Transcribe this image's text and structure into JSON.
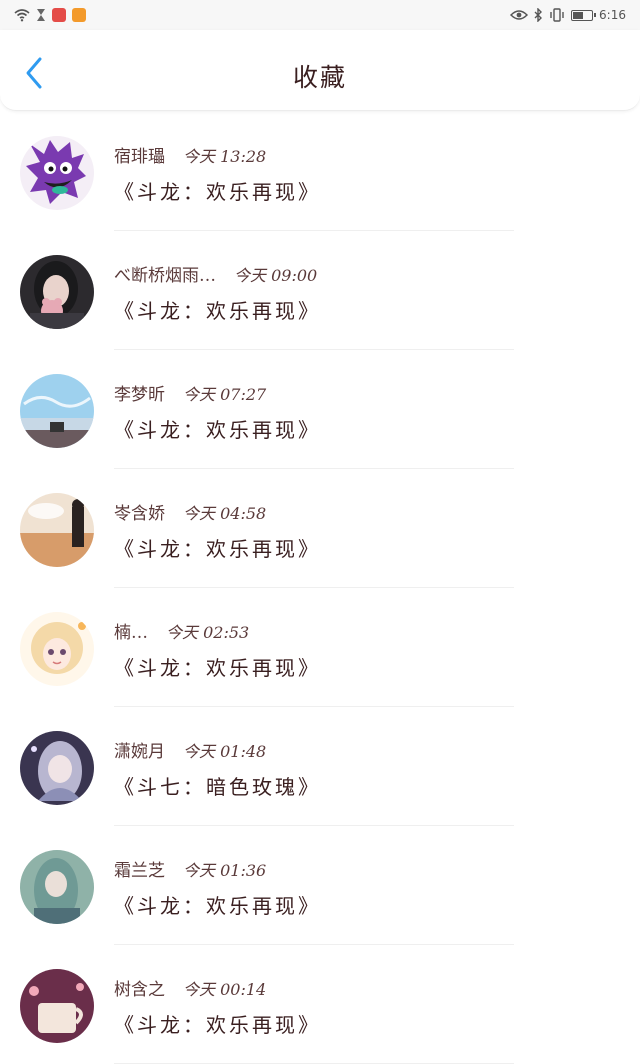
{
  "status_bar": {
    "time": "6:16",
    "icons_left": [
      "wifi-icon",
      "hourglass-icon",
      "red-app-icon",
      "orange-play-app-icon"
    ],
    "icons_right": [
      "eye-icon",
      "bluetooth-icon",
      "vibrate-icon",
      "battery-icon"
    ],
    "battery_fraction": 0.6
  },
  "header": {
    "title": "收藏",
    "back_icon": "chevron-left-icon",
    "accent_color": "#2f9bf0"
  },
  "favorites": [
    {
      "name": "宿琲瓃",
      "time": "今天 13:28",
      "work": "《斗龙：欢乐再现》",
      "avatar": "purple-cartoon-avatar"
    },
    {
      "name": "べ断桥烟雨…",
      "time": "今天 09:00",
      "work": "《斗龙：欢乐再现》",
      "avatar": "girl-with-bear-avatar"
    },
    {
      "name": "李梦昕",
      "time": "今天 07:27",
      "work": "《斗龙：欢乐再现》",
      "avatar": "sky-scene-avatar"
    },
    {
      "name": "岺含娇",
      "time": "今天 04:58",
      "work": "《斗龙：欢乐再现》",
      "avatar": "sunset-field-avatar"
    },
    {
      "name": "楠…",
      "time": "今天 02:53",
      "work": "《斗龙：欢乐再现》",
      "avatar": "anime-blonde-girl-avatar"
    },
    {
      "name": "潇婉月",
      "time": "今天 01:48",
      "work": "《斗七：暗色玫瑰》",
      "avatar": "anime-dark-girl-avatar"
    },
    {
      "name": "霜兰芝",
      "time": "今天 01:36",
      "work": "《斗龙：欢乐再现》",
      "avatar": "teal-hair-girl-avatar"
    },
    {
      "name": "树含之",
      "time": "今天 00:14",
      "work": "《斗龙：欢乐再现》",
      "avatar": "teacup-avatar"
    }
  ]
}
